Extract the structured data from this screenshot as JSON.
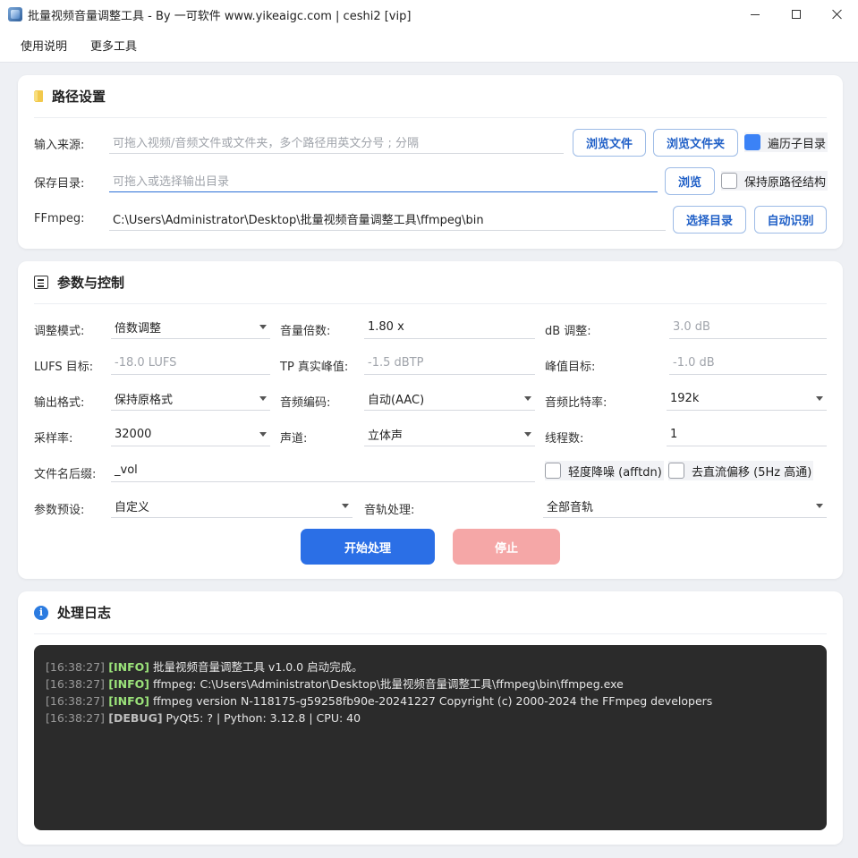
{
  "window": {
    "title": "批量视频音量调整工具 - By 一可软件  www.yikeaigc.com  |  ceshi2 [vip]"
  },
  "menu": [
    "使用说明",
    "更多工具"
  ],
  "path_section": {
    "title": "路径设置",
    "input_label": "输入来源:",
    "input_placeholder": "可拖入视频/音频文件或文件夹，多个路径用英文分号 ; 分隔",
    "browse_file": "浏览文件",
    "browse_folder": "浏览文件夹",
    "recurse_label": "遍历子目录",
    "recurse_checked": true,
    "save_label": "保存目录:",
    "save_placeholder": "可拖入或选择输出目录",
    "browse": "浏览",
    "keep_struct_label": "保持原路径结构",
    "keep_struct_checked": false,
    "ffmpeg_label": "FFmpeg:",
    "ffmpeg_path": "C:\\Users\\Administrator\\Desktop\\批量视频音量调整工具\\ffmpeg\\bin",
    "select_dir": "选择目录",
    "auto_detect": "自动识别"
  },
  "params_section": {
    "title": "参数与控制",
    "mode_label": "调整模式:",
    "mode_value": "倍数调整",
    "gain_label": "音量倍数:",
    "gain_value": "1.80 x",
    "db_label": "dB 调整:",
    "db_value": "3.0 dB",
    "lufs_label": "LUFS 目标:",
    "lufs_value": "-18.0 LUFS",
    "tp_label": "TP 真实峰值:",
    "tp_value": "-1.5 dBTP",
    "peak_label": "峰值目标:",
    "peak_value": "-1.0 dB",
    "format_label": "输出格式:",
    "format_value": "保持原格式",
    "codec_label": "音频编码:",
    "codec_value": "自动(AAC)",
    "bitrate_label": "音频比特率:",
    "bitrate_value": "192k",
    "rate_label": "采样率:",
    "rate_value": "32000",
    "channel_label": "声道:",
    "channel_value": "立体声",
    "threads_label": "线程数:",
    "threads_value": "1",
    "suffix_label": "文件名后缀:",
    "suffix_value": "_vol",
    "denoise_label": "轻度降噪 (afftdn)",
    "denoise_checked": false,
    "dc_label": "去直流偏移 (5Hz 高通)",
    "dc_checked": false,
    "preset_label": "参数预设:",
    "preset_value": "自定义",
    "track_label": "音轨处理:",
    "track_value": "全部音轨",
    "start": "开始处理",
    "stop": "停止",
    "colors": {
      "start": "#2b6fe6",
      "stop": "#f5a7a7"
    }
  },
  "log_section": {
    "title": "处理日志",
    "lines": [
      {
        "time": "[16:38:27]",
        "level": "[INFO]",
        "msg": "批量视频音量调整工具 v1.0.0 启动完成。"
      },
      {
        "time": "[16:38:27]",
        "level": "[INFO]",
        "msg": "ffmpeg: C:\\Users\\Administrator\\Desktop\\批量视频音量调整工具\\ffmpeg\\bin\\ffmpeg.exe"
      },
      {
        "time": "[16:38:27]",
        "level": "[INFO]",
        "msg": "ffmpeg version N-118175-g59258fb90e-20241227 Copyright (c) 2000-2024 the FFmpeg developers"
      },
      {
        "time": "[16:38:27]",
        "level": "[DEBUG]",
        "msg": "PyQt5: ? | Python: 3.12.8 | CPU: 40"
      }
    ]
  }
}
